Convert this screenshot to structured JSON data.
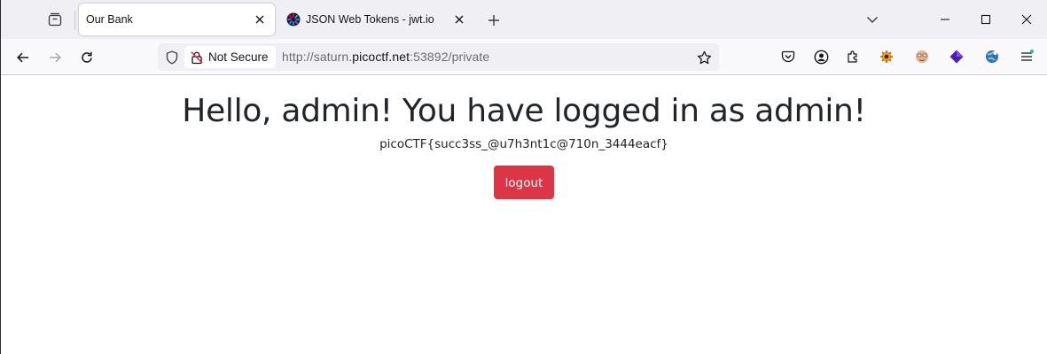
{
  "browser": {
    "tabs": [
      {
        "title": "Our Bank",
        "active": true
      },
      {
        "title": "JSON Web Tokens - jwt.io",
        "active": false
      }
    ],
    "address_bar": {
      "security_label": "Not Secure",
      "url_prefix": "http://saturn.",
      "url_domain": "picoctf.net",
      "url_suffix": ":53892/private"
    }
  },
  "page": {
    "heading": "Hello, admin! You have logged in as admin!",
    "flag": "picoCTF{succ3ss_@u7h3nt1c@710n_3444eacf}",
    "logout_label": "logout"
  },
  "colors": {
    "logout_button": "#dc3545",
    "tabstrip_bg": "#f0f0f4",
    "navbar_bg": "#f9f9fb"
  }
}
